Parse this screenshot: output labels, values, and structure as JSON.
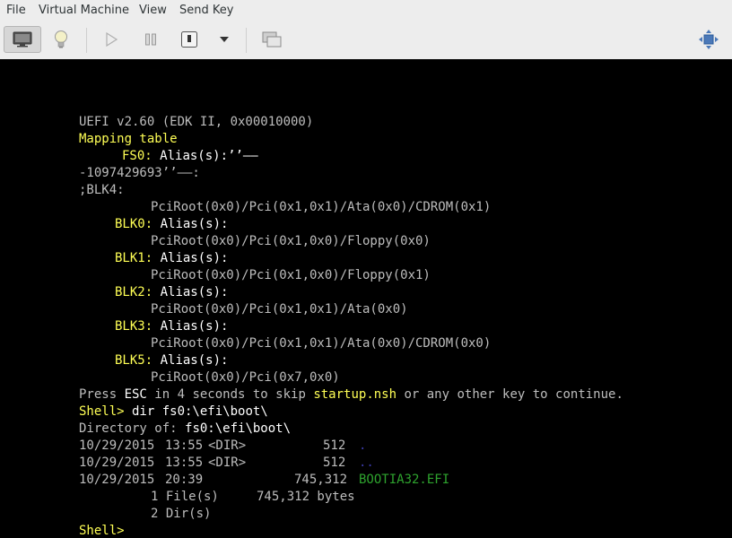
{
  "menu": {
    "file": "File",
    "virtual_machine": "Virtual Machine",
    "view": "View",
    "send_key": "Send Key"
  },
  "toolbar": {
    "console_icon": "monitor-icon",
    "details_icon": "lightbulb-icon",
    "run_icon": "play-icon",
    "pause_icon": "pause-icon",
    "shutdown_icon": "power-icon",
    "shutdown_menu_icon": "chevron-down-icon",
    "snapshots_icon": "snapshots-icon",
    "fullscreen_icon": "fullscreen-icon"
  },
  "console": {
    "uefi_version": "UEFI v2.60 (EDK II, 0x00010000)",
    "mapping_title": "Mapping table",
    "fs0_label": "FS0:",
    "fs0_alias": "Alias(s):’’——",
    "fs0_alias_cont": "-1097429693’’——:",
    "blk4": ";BLK4:",
    "blk4_path": "PciRoot(0x0)/Pci(0x1,0x1)/Ata(0x0)/CDROM(0x1)",
    "alias_text": "Alias(s):",
    "blk0_label": "BLK0:",
    "blk0_path": "PciRoot(0x0)/Pci(0x1,0x0)/Floppy(0x0)",
    "blk1_label": "BLK1:",
    "blk1_path": "PciRoot(0x0)/Pci(0x1,0x0)/Floppy(0x1)",
    "blk2_label": "BLK2:",
    "blk2_path": "PciRoot(0x0)/Pci(0x1,0x1)/Ata(0x0)",
    "blk3_label": "BLK3:",
    "blk3_path": "PciRoot(0x0)/Pci(0x1,0x1)/Ata(0x0)/CDROM(0x0)",
    "blk5_label": "BLK5:",
    "blk5_path": "PciRoot(0x0)/Pci(0x7,0x0)",
    "press_pre": "Press ",
    "press_esc": "ESC",
    "press_mid": " in 4 seconds to skip ",
    "press_startup": "startup.nsh",
    "press_post": " or any other key to continue.",
    "prompt": "Shell>",
    "command": " dir fs0:\\efi\\boot\\",
    "dir_of_label": "Directory of: ",
    "dir_of_path": "fs0:\\efi\\boot\\",
    "entries": [
      {
        "date": "10/29/2015",
        "time": "13:55",
        "type": "<DIR>",
        "size": "512",
        "name": "."
      },
      {
        "date": "10/29/2015",
        "time": "13:55",
        "type": "<DIR>",
        "size": "512",
        "name": ".."
      },
      {
        "date": "10/29/2015",
        "time": "20:39",
        "type": "",
        "size": "745,312",
        "name": "BOOTIA32.EFI"
      }
    ],
    "summary_files": "1 File(s)     745,312 bytes",
    "summary_dirs": "2 Dir(s)",
    "final_prompt": "Shell>"
  }
}
